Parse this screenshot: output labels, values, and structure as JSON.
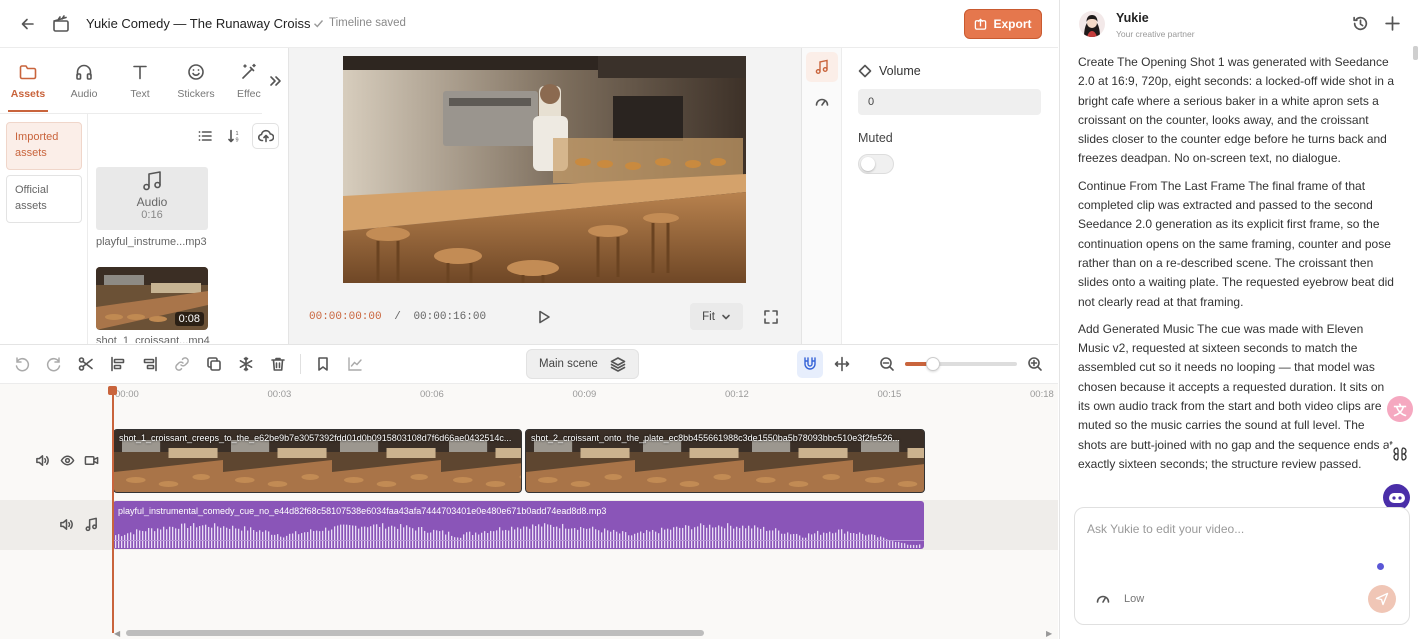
{
  "header": {
    "title": "Yukie Comedy — The Runaway Croiss",
    "save_status": "Timeline saved",
    "export_label": "Export"
  },
  "asset_tabs": [
    {
      "label": "Assets",
      "icon": "folder-icon",
      "active": true
    },
    {
      "label": "Audio",
      "icon": "headphones-icon",
      "active": false
    },
    {
      "label": "Text",
      "icon": "text-icon",
      "active": false
    },
    {
      "label": "Stickers",
      "icon": "smiley-icon",
      "active": false
    },
    {
      "label": "Effec",
      "icon": "magic-wand-icon",
      "active": false
    }
  ],
  "asset_categories": [
    {
      "label": "Imported assets",
      "active": true
    },
    {
      "label": "Official assets",
      "active": false
    }
  ],
  "assets": [
    {
      "type": "audio",
      "kind_label": "Audio",
      "duration": "0:16",
      "name": "playful_instrume...mp3"
    },
    {
      "type": "video",
      "duration": "0:08",
      "name": "shot_1_croissant...mp4"
    }
  ],
  "preview": {
    "current_time": "00:00:00:00",
    "separator": "/",
    "total_time": "00:00:16:00",
    "fit_label": "Fit"
  },
  "properties": {
    "volume_label": "Volume",
    "volume_value": "0",
    "muted_label": "Muted",
    "muted": false
  },
  "toolbar": {
    "scene_label": "Main scene",
    "zoom_level": 0.25
  },
  "timeline": {
    "ticks": [
      "00:00",
      "00:03",
      "00:06",
      "00:09",
      "00:12",
      "00:15",
      "00:18"
    ],
    "clips": [
      {
        "name": "shot_1_croissant_creeps_to_the_e62be9b7e3057392fdd01d0b0915803108d7f6d66ae0432514c..."
      },
      {
        "name": "shot_2_croissant_onto_the_plate_ec8bb455661988c3de1550ba5b78093bbc510e3f2fe526..."
      }
    ],
    "audio_clip": {
      "name": "playful_instrumental_comedy_cue_no_e44d82f68c58107538e6034faa43afa7444703401e0e480e671b0add74ead8d8.mp3"
    }
  },
  "chat": {
    "agent_name": "Yukie",
    "agent_subtitle": "Your creative partner",
    "messages": [
      "Create The Opening Shot 1 was generated with Seedance 2.0 at 16:9, 720p, eight seconds: a locked-off wide shot in a bright cafe where a serious baker in a white apron sets a croissant on the counter, looks away, and the croissant slides closer to the counter edge before he turns back and freezes deadpan. No on-screen text, no dialogue.",
      "Continue From The Last Frame The final frame of that completed clip was extracted and passed to the second Seedance 2.0 generation as its explicit first frame, so the continuation opens on the same framing, counter and pose rather than on a re-described scene. The croissant then slides onto a waiting plate. The requested eyebrow beat did not clearly read at that framing.",
      "Add Generated Music The cue was made with Eleven Music v2, requested at sixteen seconds to match the assembled cut so it needs no looping — that model was chosen because it accepts a requested duration. It sits on its own audio track from the start and both video clips are muted so the music carries the sound at full level. The shots are butt-joined with no gap and the sequence ends at exactly sixteen seconds; the structure review passed."
    ],
    "input_placeholder": "Ask Yukie to edit your video...",
    "effort_label": "Low"
  },
  "colors": {
    "accent": "#e5774d",
    "audio_clip": "#8a55b8",
    "playhead": "#c9643c"
  }
}
